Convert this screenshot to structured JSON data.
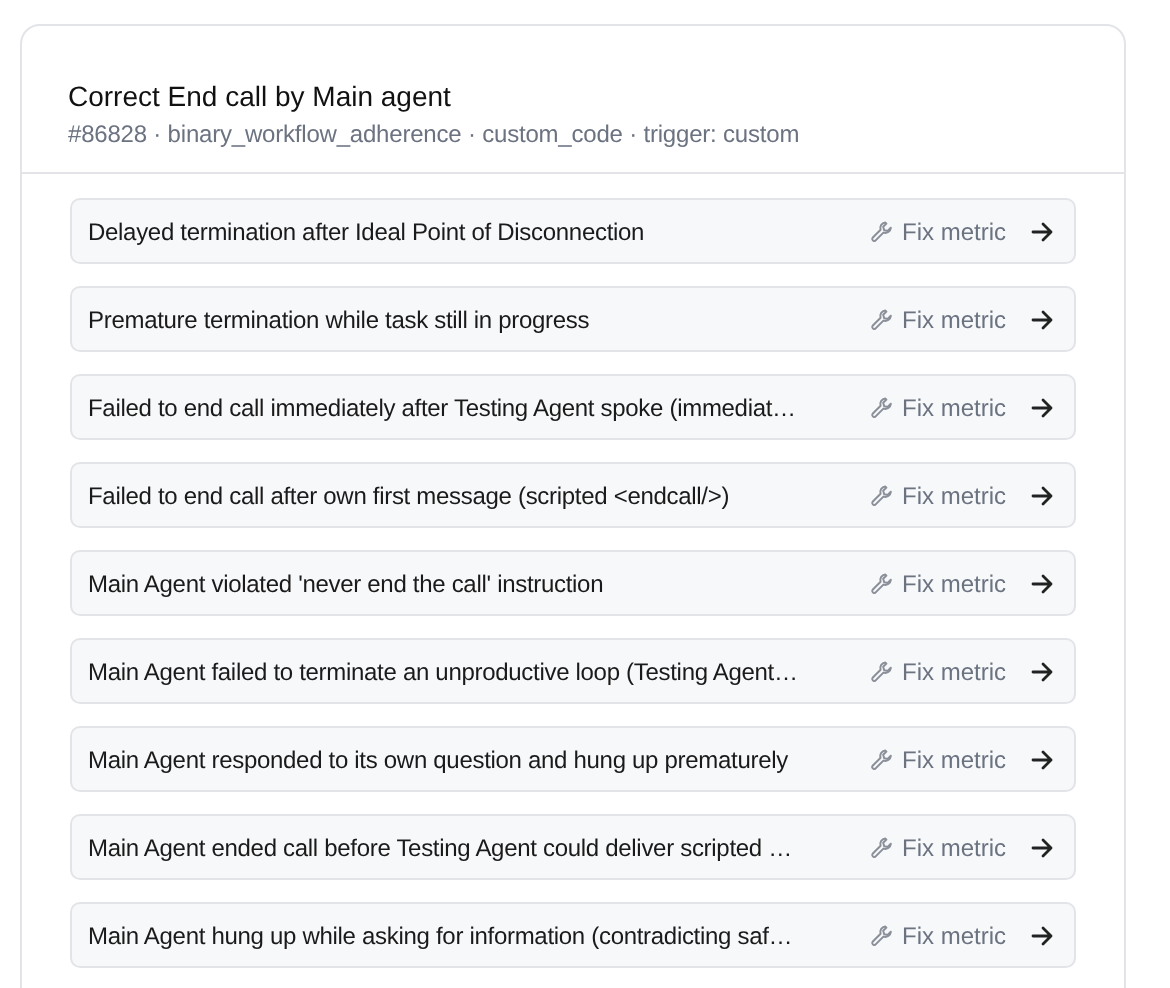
{
  "card": {
    "title": "Correct End call by Main agent",
    "subtitle": "#86828 · binary_workflow_adherence · custom_code · trigger: custom"
  },
  "issues": [
    {
      "label": "Delayed termination after Ideal Point of Disconnection",
      "action": "Fix metric"
    },
    {
      "label": "Premature termination while task still in progress",
      "action": "Fix metric"
    },
    {
      "label": "Failed to end call immediately after Testing Agent spoke (immediat…",
      "action": "Fix metric"
    },
    {
      "label": "Failed to end call after own first message (scripted <endcall/>)",
      "action": "Fix metric"
    },
    {
      "label": "Main Agent violated 'never end the call' instruction",
      "action": "Fix metric"
    },
    {
      "label": "Main Agent failed to terminate an unproductive loop (Testing Agent…",
      "action": "Fix metric"
    },
    {
      "label": "Main Agent responded to its own question and hung up prematurely",
      "action": "Fix metric"
    },
    {
      "label": "Main Agent ended call before Testing Agent could deliver scripted …",
      "action": "Fix metric"
    },
    {
      "label": "Main Agent hung up while asking for information (contradicting saf…",
      "action": "Fix metric"
    }
  ]
}
